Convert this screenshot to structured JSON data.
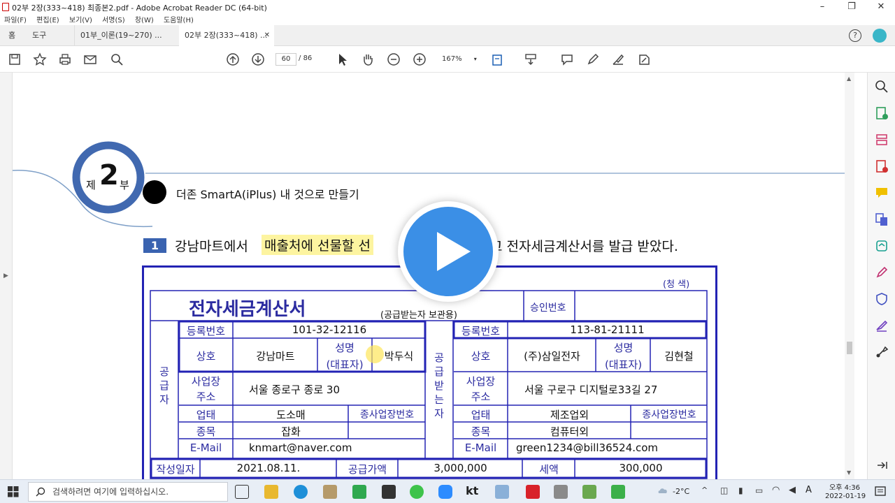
{
  "window": {
    "title": "02부 2장(333~418) 최종본2.pdf - Adobe Acrobat Reader DC (64-bit)"
  },
  "menu": [
    "파일(F)",
    "편집(E)",
    "보기(V)",
    "서명(S)",
    "창(W)",
    "도움말(H)"
  ],
  "tabs": {
    "home": "홈",
    "tools": "도구",
    "doc1": "01부_이론(19~270) ...",
    "doc2": "02부 2장(333~418) ..."
  },
  "toolbar": {
    "page_current": "60",
    "page_sep": "/",
    "page_total": "86",
    "zoom": "167%"
  },
  "page": {
    "part_prefix": "제",
    "part_number": "2",
    "part_suffix": "부",
    "section_title": "더존 SmartA(iPlus) 내 것으로 만들기",
    "question_number": "1",
    "question_a": "강남마트에서",
    "question_highlight": "매출처에 선물할 선",
    "question_b": "고 전자세금계산서를 발급 받았다."
  },
  "invoice": {
    "color_note": "(청   색)",
    "title": "전자세금계산서",
    "subtitle": "(공급받는자 보관용)",
    "approval_label": "승인번호",
    "supplier_label": "공급자",
    "buyer_label": "공급받는자",
    "reg_label": "등록번호",
    "name_label": "상호",
    "rep_label_1": "성명",
    "rep_label_2": "(대표자)",
    "addr_label_1": "사업장",
    "addr_label_2": "주소",
    "biz_type_label": "업태",
    "branch_label": "종사업장번호",
    "item_label": "종목",
    "email_label": "E-Mail",
    "supplier": {
      "reg": "101-32-12116",
      "name": "강남마트",
      "rep": "박두식",
      "addr": "서울 종로구 종로 30",
      "biz_type": "도소매",
      "item": "잡화",
      "email": "knmart@naver.com"
    },
    "buyer": {
      "reg": "113-81-21111",
      "name": "(주)삼일전자",
      "rep": "김현철",
      "addr": "서울 구로구 디지털로33길 27",
      "biz_type": "제조업외",
      "item": "컴퓨터외",
      "email": "green1234@bill36524.com"
    },
    "date_label": "작성일자",
    "date": "2021.08.11.",
    "supply_label": "공급가액",
    "supply": "3,000,000",
    "tax_label": "세액",
    "tax": "300,000"
  },
  "taskbar": {
    "search_placeholder": "검색하려면 여기에 입력하십시오.",
    "weather": "-2°C",
    "ime": "A",
    "time_1": "오후 4:36",
    "time_2": "2022-01-19",
    "kt": "kt"
  },
  "colors": {
    "accent": "#2323b4",
    "play": "#3b8fe6"
  }
}
